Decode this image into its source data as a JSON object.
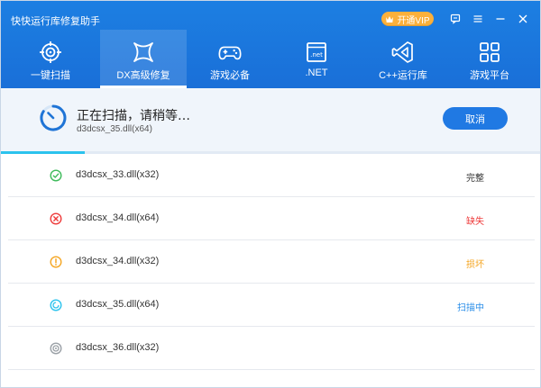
{
  "app": {
    "title": "快快运行库修复助手"
  },
  "vip": {
    "label": "开通VIP"
  },
  "nav": [
    {
      "label": "一键扫描",
      "icon": "target-scan-icon",
      "active": false
    },
    {
      "label": "DX高级修复",
      "icon": "dx-x-icon",
      "active": true
    },
    {
      "label": "游戏必备",
      "icon": "gamepad-icon",
      "active": false
    },
    {
      "label": ".NET",
      "icon": "dotnet-window-icon",
      "active": false
    },
    {
      "label": "C++运行库",
      "icon": "visual-studio-icon",
      "active": false
    },
    {
      "label": "游戏平台",
      "icon": "grid-apps-icon",
      "active": false
    }
  ],
  "scan": {
    "title": "正在扫描，请稍等…",
    "current_file": "d3dcsx_35.dll(x64)",
    "cancel_label": "取消",
    "progress_fraction": 0.155
  },
  "items": [
    {
      "name": "d3dcsx_33.dll(x32)",
      "status": "完整",
      "state": "ok"
    },
    {
      "name": "d3dcsx_34.dll(x64)",
      "status": "缺失",
      "state": "missing"
    },
    {
      "name": "d3dcsx_34.dll(x32)",
      "status": "损坏",
      "state": "damaged"
    },
    {
      "name": "d3dcsx_35.dll(x64)",
      "status": "扫描中",
      "state": "scanning"
    },
    {
      "name": "d3dcsx_36.dll(x32)",
      "status": "",
      "state": "pending"
    }
  ],
  "colors": {
    "ok": "#3dba5a",
    "missing": "#ee3b3b",
    "damaged": "#f5a623",
    "scanning": "#2a8ee8",
    "pending": "#9aa0a6"
  }
}
